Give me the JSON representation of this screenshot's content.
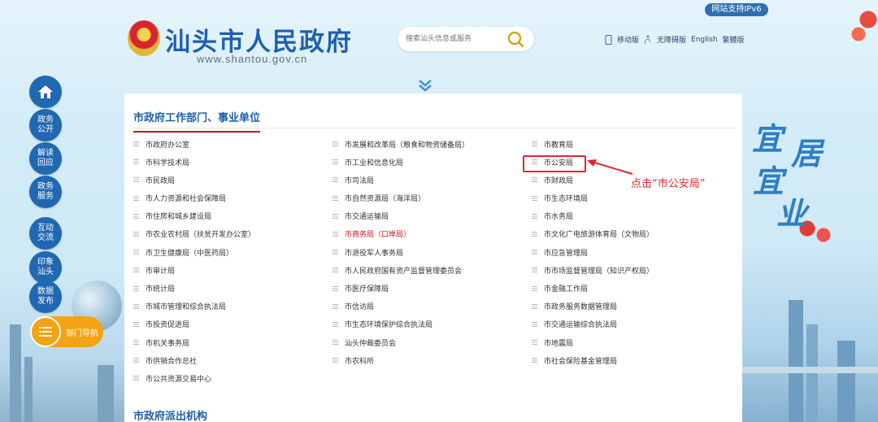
{
  "header": {
    "ipv6_badge": "网站支持IPv6",
    "site_title": "汕头市人民政府",
    "site_url": "www.shantou.gov.cn",
    "search_placeholder": "搜索汕头信息或服务",
    "links": [
      "移动版",
      "无障碍版",
      "English",
      "繁體版"
    ]
  },
  "sidenav": {
    "items": [
      "政务公开",
      "解读回应",
      "政务服务",
      "互动交流",
      "印象汕头",
      "数据发布"
    ],
    "dept_nav_label": "部门导航"
  },
  "slogan": [
    "宜",
    "居",
    "宜",
    "业"
  ],
  "section": {
    "title": "市政府工作部门、事业单位",
    "rows": [
      [
        "市政府办公室",
        "市发展和改革局（粮食和物资储备局）",
        "市教育局"
      ],
      [
        "市科学技术局",
        "市工业和信息化局",
        "市公安局"
      ],
      [
        "市民政局",
        "市司法局",
        "市财政局"
      ],
      [
        "市人力资源和社会保障局",
        "市自然资源局（海洋局）",
        "市生态环境局"
      ],
      [
        "市住房和城乡建设局",
        "市交通运输局",
        "市水务局"
      ],
      [
        "市农业农村局（扶贫开发办公室）",
        "市商务局（口岸局）",
        "市文化广电旅游体育局（文物局）"
      ],
      [
        "市卫生健康局（中医药局）",
        "市退役军人事务局",
        "市应急管理局"
      ],
      [
        "市审计局",
        "市人民政府国有资产监督管理委员会",
        "市市场监督管理局（知识产权局）"
      ],
      [
        "市统计局",
        "市医疗保障局",
        "市金融工作局"
      ],
      [
        "市城市管理和综合执法局",
        "市信访局",
        "市政务服务数据管理局"
      ],
      [
        "市投资促进局",
        "市生态环境保护综合执法局",
        "市交通运输综合执法局"
      ],
      [
        "市机关事务局",
        "汕头仲裁委员会",
        "市地震局"
      ],
      [
        "市供销合作总社",
        "市农科所",
        "市社会保险基金管理局"
      ],
      [
        "市公共资源交易中心",
        "",
        ""
      ]
    ],
    "highlighted_red": "市商务局（口岸局）"
  },
  "section2_title": "市政府派出机构",
  "annotation": {
    "text": "点击“市公安局”",
    "target": "市公安局"
  },
  "colors": {
    "primary_blue": "#2168b3",
    "title_blue": "#1f5fa8",
    "accent_red": "#c8161e",
    "annotation_red": "#e3262c",
    "dept_nav_orange": "#f3a313"
  }
}
